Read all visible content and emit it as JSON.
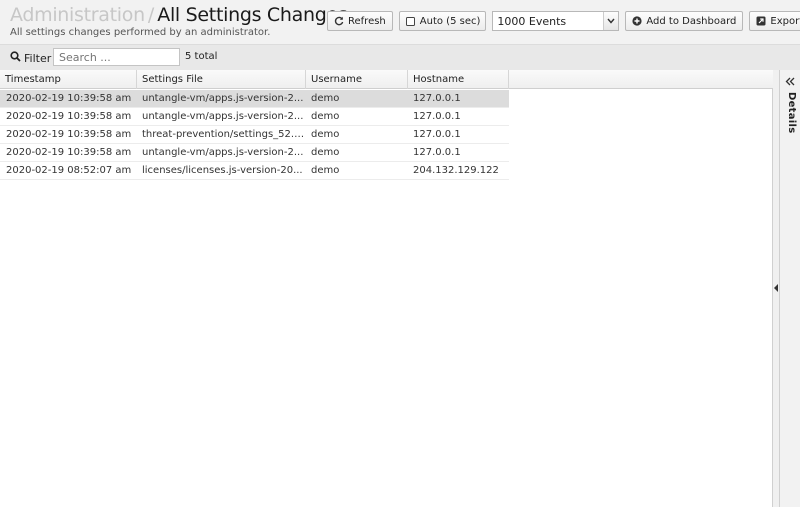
{
  "header": {
    "parent_title": "Administration",
    "separator": "/",
    "title": "All Settings Changes",
    "subtitle": "All settings changes performed by an administrator."
  },
  "toolbar": {
    "refresh_label": "Refresh",
    "auto_label": "Auto (5 sec)",
    "events_select_value": "1000 Events",
    "add_dashboard_label": "Add to Dashboard",
    "export_label": "Export Data"
  },
  "filter": {
    "label": "Filter",
    "placeholder": "Search ...",
    "total": "5 total"
  },
  "grid": {
    "columns": [
      "Timestamp",
      "Settings File",
      "Username",
      "Hostname"
    ],
    "rows": [
      {
        "timestamp": "2020-02-19 10:39:58 am",
        "file": "untangle-vm/apps.js-version-2...",
        "username": "demo",
        "hostname": "127.0.0.1"
      },
      {
        "timestamp": "2020-02-19 10:39:58 am",
        "file": "untangle-vm/apps.js-version-2...",
        "username": "demo",
        "hostname": "127.0.0.1"
      },
      {
        "timestamp": "2020-02-19 10:39:58 am",
        "file": "threat-prevention/settings_52.j...",
        "username": "demo",
        "hostname": "127.0.0.1"
      },
      {
        "timestamp": "2020-02-19 10:39:58 am",
        "file": "untangle-vm/apps.js-version-2...",
        "username": "demo",
        "hostname": "127.0.0.1"
      },
      {
        "timestamp": "2020-02-19 08:52:07 am",
        "file": "licenses/licenses.js-version-20...",
        "username": "demo",
        "hostname": "204.132.129.122"
      }
    ]
  },
  "details": {
    "label": "Details"
  }
}
